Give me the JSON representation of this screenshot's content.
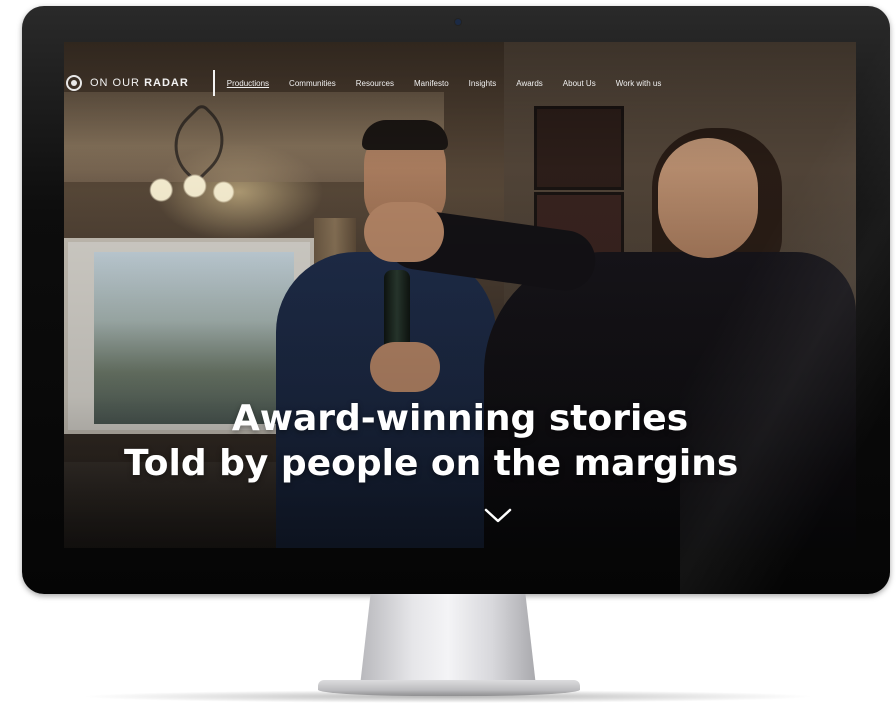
{
  "site": {
    "logo_prefix": "ON OUR",
    "logo_bold": "RADAR"
  },
  "nav": {
    "items": [
      {
        "label": "Productions"
      },
      {
        "label": "Communities"
      },
      {
        "label": "Resources"
      },
      {
        "label": "Manifesto"
      },
      {
        "label": "Insights"
      },
      {
        "label": "Awards"
      },
      {
        "label": "About Us"
      },
      {
        "label": "Work with us"
      }
    ]
  },
  "hero": {
    "line1": "Award-winning stories",
    "line2": "Told by people on the margins"
  },
  "icons": {
    "scroll": "chevron-down-icon",
    "logo": "radar-logo-icon"
  },
  "colors": {
    "text": "#ffffff",
    "bezel": "#0d0d0d"
  }
}
